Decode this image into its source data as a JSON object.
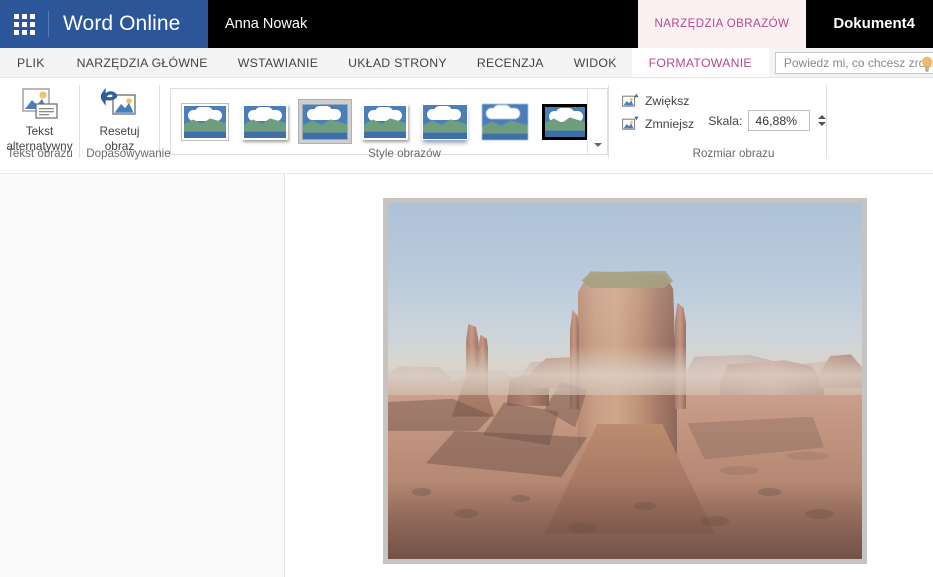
{
  "suitebar": {
    "waffle_icon": "app-launcher-grid-icon",
    "brand": "Word Online",
    "username": "Anna Nowak",
    "contextual_tab": "NARZĘDZIA OBRAZÓW",
    "document_title": "Dokument4"
  },
  "tabs": [
    {
      "label": "PLIK",
      "active": false
    },
    {
      "label": "NARZĘDZIA GŁÓWNE",
      "active": false
    },
    {
      "label": "WSTAWIANIE",
      "active": false
    },
    {
      "label": "UKŁAD STRONY",
      "active": false
    },
    {
      "label": "RECENZJA",
      "active": false
    },
    {
      "label": "WIDOK",
      "active": false
    },
    {
      "label": "FORMATOWANIE",
      "active": true
    }
  ],
  "tellme": {
    "placeholder": "Powiedz mi, co chcesz zrobić",
    "icon": "lightbulb-icon"
  },
  "ribbon": {
    "groups": [
      {
        "name": "alt-text",
        "label": "Tekst obrazu",
        "buttons": [
          {
            "label": "Tekst\nalternatywny",
            "line1": "Tekst",
            "line2": "alternatywny",
            "icon": "picture-with-caption-icon"
          }
        ]
      },
      {
        "name": "adjust",
        "label": "Dopasowywanie",
        "buttons": [
          {
            "label": "Resetuj\nobraz",
            "line1": "Resetuj",
            "line2": "obraz",
            "icon": "reset-picture-icon"
          }
        ]
      },
      {
        "name": "picture-styles",
        "label": "Style obrazów",
        "more_icon": "chevron-down-icon",
        "items": [
          {
            "name": "simple-frame-white",
            "selected": false
          },
          {
            "name": "beveled-matte-white",
            "selected": false
          },
          {
            "name": "metal-frame",
            "selected": true
          },
          {
            "name": "drop-shadow-rectangle",
            "selected": false
          },
          {
            "name": "reflected-rounded-rectangle",
            "selected": false
          },
          {
            "name": "soft-edge-oval",
            "selected": false
          },
          {
            "name": "thick-black-frame",
            "selected": false
          }
        ]
      },
      {
        "name": "image-size",
        "label": "Rozmiar obrazu",
        "increase_label": "Zwiększ",
        "increase_icon": "increase-image-icon",
        "decrease_label": "Zmniejsz",
        "decrease_icon": "decrease-image-icon",
        "scale_label": "Skala:",
        "scale_value": "46,88%",
        "spinner_icon": "spinner-up-down-icon"
      }
    ]
  },
  "document": {
    "picture": {
      "name": "monument-valley-photo",
      "alt": "Desert landscape with sandstone buttes at sunrise"
    }
  },
  "colors": {
    "brand_blue": "#2b579a",
    "suitebar_black": "#000000",
    "contextual_pink": "#b4498b",
    "contextual_tab_bg": "#fcf0f3",
    "ribbon_bg": "#ffffff",
    "tabrow_bg": "#f4f4f4",
    "text_gray": "#444444",
    "group_label_gray": "#6b6b6b",
    "picture_frame_gray": "#c6c3c0",
    "left_pane_bg": "#fafafa"
  }
}
